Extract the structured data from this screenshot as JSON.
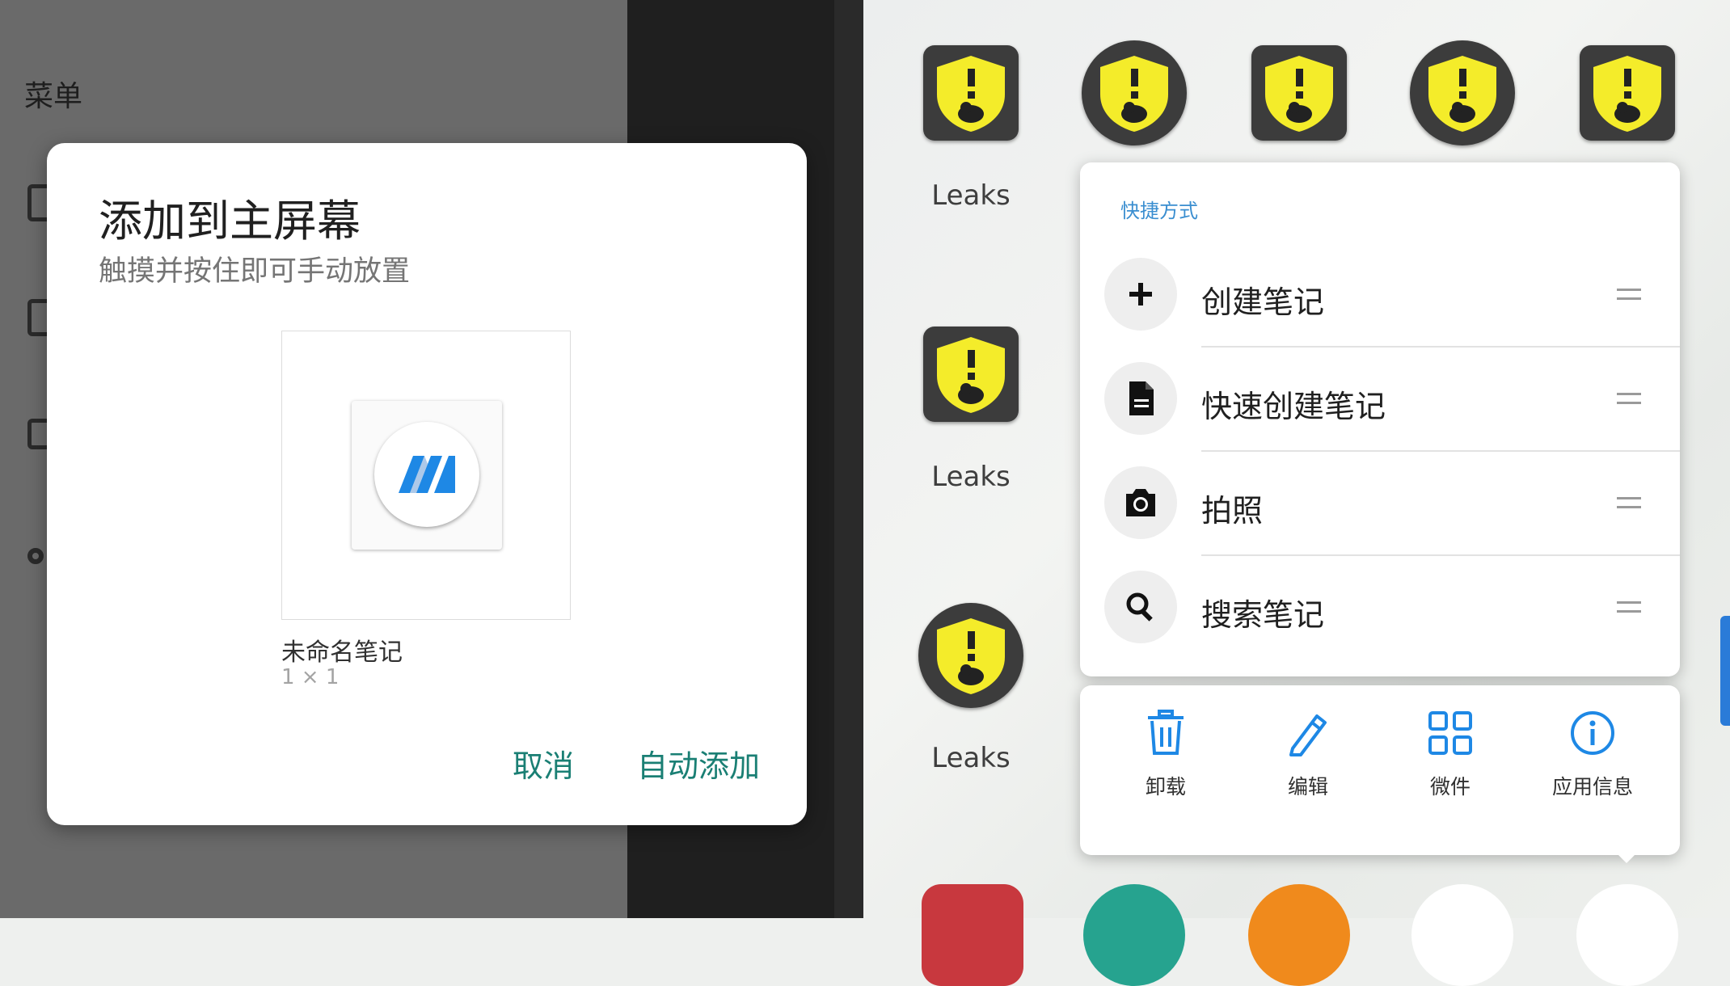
{
  "left": {
    "menu_label": "菜单"
  },
  "dialog": {
    "title": "添加到主屏幕",
    "subtitle": "触摸并按住即可手动放置",
    "widget_name": "未命名笔记",
    "widget_size": "1 × 1",
    "cancel_label": "取消",
    "auto_add_label": "自动添加"
  },
  "launcher": {
    "app_label": "Leaks",
    "labels": [
      "Leaks",
      "Leaks",
      "Leaks"
    ]
  },
  "shortcuts": {
    "title": "快捷方式",
    "items": [
      {
        "label": "创建笔记",
        "icon": "plus-icon"
      },
      {
        "label": "快速创建笔记",
        "icon": "document-icon"
      },
      {
        "label": "拍照",
        "icon": "camera-icon"
      },
      {
        "label": "搜索笔记",
        "icon": "search-icon"
      }
    ]
  },
  "actions": {
    "items": [
      {
        "label": "卸载",
        "icon": "trash-icon"
      },
      {
        "label": "编辑",
        "icon": "pencil-icon"
      },
      {
        "label": "微件",
        "icon": "widgets-icon"
      },
      {
        "label": "应用信息",
        "icon": "info-icon"
      }
    ]
  },
  "colors": {
    "accent_teal": "#1a7f74",
    "accent_blue": "#1e88e5",
    "leaks_yellow": "#f4ec2a",
    "leaks_dark": "#3c3c3c"
  }
}
